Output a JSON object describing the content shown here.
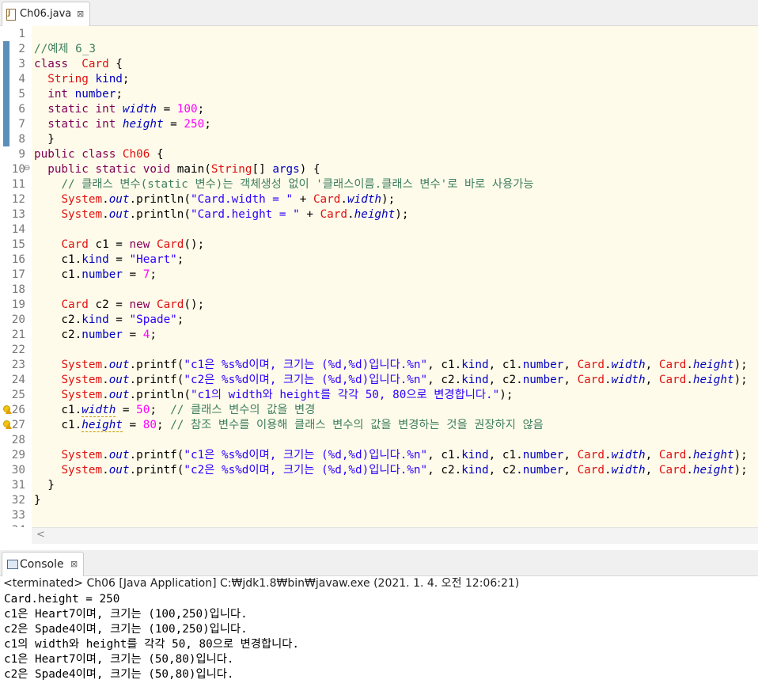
{
  "editor": {
    "tab_label": "Ch06.java",
    "tab_close": "⊠"
  },
  "code_lines": [
    {
      "n": "1",
      "t": []
    },
    {
      "n": "2",
      "t": [
        [
          "cmt",
          "//예제 6_3"
        ]
      ]
    },
    {
      "n": "3",
      "t": [
        [
          "kw",
          "class"
        ],
        [
          "",
          "  "
        ],
        [
          "cls",
          "Card"
        ],
        [
          "",
          " {"
        ]
      ]
    },
    {
      "n": "4",
      "t": [
        [
          "",
          "  "
        ],
        [
          "cls",
          "String"
        ],
        [
          "",
          " "
        ],
        [
          "fld",
          "kind"
        ],
        [
          "",
          ";"
        ]
      ]
    },
    {
      "n": "5",
      "t": [
        [
          "",
          "  "
        ],
        [
          "kw",
          "int"
        ],
        [
          "",
          " "
        ],
        [
          "fld",
          "number"
        ],
        [
          "",
          ";"
        ]
      ]
    },
    {
      "n": "6",
      "t": [
        [
          "",
          "  "
        ],
        [
          "kw",
          "static"
        ],
        [
          "",
          " "
        ],
        [
          "kw",
          "int"
        ],
        [
          "",
          " "
        ],
        [
          "sfld",
          "width"
        ],
        [
          "",
          " = "
        ],
        [
          "num",
          "100"
        ],
        [
          "",
          ";"
        ]
      ]
    },
    {
      "n": "7",
      "t": [
        [
          "",
          "  "
        ],
        [
          "kw",
          "static"
        ],
        [
          "",
          " "
        ],
        [
          "kw",
          "int"
        ],
        [
          "",
          " "
        ],
        [
          "sfld",
          "height"
        ],
        [
          "",
          " = "
        ],
        [
          "num",
          "250"
        ],
        [
          "",
          ";"
        ]
      ]
    },
    {
      "n": "8",
      "t": [
        [
          "",
          "  }"
        ]
      ]
    },
    {
      "n": "9",
      "t": [
        [
          "kw",
          "public"
        ],
        [
          "",
          " "
        ],
        [
          "kw",
          "class"
        ],
        [
          "",
          " "
        ],
        [
          "cls",
          "Ch06"
        ],
        [
          "",
          " {"
        ]
      ]
    },
    {
      "n": "10",
      "t": [
        [
          "",
          "  "
        ],
        [
          "kw",
          "public"
        ],
        [
          "",
          " "
        ],
        [
          "kw",
          "static"
        ],
        [
          "",
          " "
        ],
        [
          "kw",
          "void"
        ],
        [
          "",
          " main("
        ],
        [
          "cls",
          "String"
        ],
        [
          "",
          "[] "
        ],
        [
          "fld",
          "args"
        ],
        [
          "",
          ") {"
        ]
      ]
    },
    {
      "n": "11",
      "t": [
        [
          "",
          "    "
        ],
        [
          "cmt",
          "// 클래스 변수(static 변수)는 객체생성 없이 '클래스이름.클래스 변수'로 바로 사용가능"
        ]
      ]
    },
    {
      "n": "12",
      "t": [
        [
          "",
          "    "
        ],
        [
          "cls",
          "System"
        ],
        [
          "",
          "."
        ],
        [
          "out",
          "out"
        ],
        [
          "",
          ".println("
        ],
        [
          "str",
          "\"Card.width = \""
        ],
        [
          "",
          " + "
        ],
        [
          "cls",
          "Card"
        ],
        [
          "",
          "."
        ],
        [
          "sfld",
          "width"
        ],
        [
          "",
          ");"
        ]
      ]
    },
    {
      "n": "13",
      "t": [
        [
          "",
          "    "
        ],
        [
          "cls",
          "System"
        ],
        [
          "",
          "."
        ],
        [
          "out",
          "out"
        ],
        [
          "",
          ".println("
        ],
        [
          "str",
          "\"Card.height = \""
        ],
        [
          "",
          " + "
        ],
        [
          "cls",
          "Card"
        ],
        [
          "",
          "."
        ],
        [
          "sfld",
          "height"
        ],
        [
          "",
          ");"
        ]
      ]
    },
    {
      "n": "14",
      "t": []
    },
    {
      "n": "15",
      "t": [
        [
          "",
          "    "
        ],
        [
          "cls",
          "Card"
        ],
        [
          "",
          " c1 = "
        ],
        [
          "kw",
          "new"
        ],
        [
          "",
          " "
        ],
        [
          "cls",
          "Card"
        ],
        [
          "",
          "();"
        ]
      ]
    },
    {
      "n": "16",
      "t": [
        [
          "",
          "    c1."
        ],
        [
          "fld",
          "kind"
        ],
        [
          "",
          " = "
        ],
        [
          "str",
          "\"Heart\""
        ],
        [
          "",
          ";"
        ]
      ]
    },
    {
      "n": "17",
      "t": [
        [
          "",
          "    c1."
        ],
        [
          "fld",
          "number"
        ],
        [
          "",
          " = "
        ],
        [
          "num",
          "7"
        ],
        [
          "",
          ";"
        ]
      ]
    },
    {
      "n": "18",
      "t": []
    },
    {
      "n": "19",
      "t": [
        [
          "",
          "    "
        ],
        [
          "cls",
          "Card"
        ],
        [
          "",
          " c2 = "
        ],
        [
          "kw",
          "new"
        ],
        [
          "",
          " "
        ],
        [
          "cls",
          "Card"
        ],
        [
          "",
          "();"
        ]
      ]
    },
    {
      "n": "20",
      "t": [
        [
          "",
          "    c2."
        ],
        [
          "fld",
          "kind"
        ],
        [
          "",
          " = "
        ],
        [
          "str",
          "\"Spade\""
        ],
        [
          "",
          ";"
        ]
      ]
    },
    {
      "n": "21",
      "t": [
        [
          "",
          "    c2."
        ],
        [
          "fld",
          "number"
        ],
        [
          "",
          " = "
        ],
        [
          "num",
          "4"
        ],
        [
          "",
          ";"
        ]
      ]
    },
    {
      "n": "22",
      "t": []
    },
    {
      "n": "23",
      "t": [
        [
          "",
          "    "
        ],
        [
          "cls",
          "System"
        ],
        [
          "",
          "."
        ],
        [
          "out",
          "out"
        ],
        [
          "",
          ".printf("
        ],
        [
          "str",
          "\"c1은 %s%d이며, 크기는 (%d,%d)입니다.%n\""
        ],
        [
          "",
          ", c1."
        ],
        [
          "fld",
          "kind"
        ],
        [
          "",
          ", c1."
        ],
        [
          "fld",
          "number"
        ],
        [
          "",
          ", "
        ],
        [
          "cls",
          "Card"
        ],
        [
          "",
          "."
        ],
        [
          "sfld",
          "width"
        ],
        [
          "",
          ", "
        ],
        [
          "cls",
          "Card"
        ],
        [
          "",
          "."
        ],
        [
          "sfld",
          "height"
        ],
        [
          "",
          ");"
        ]
      ]
    },
    {
      "n": "24",
      "t": [
        [
          "",
          "    "
        ],
        [
          "cls",
          "System"
        ],
        [
          "",
          "."
        ],
        [
          "out",
          "out"
        ],
        [
          "",
          ".printf("
        ],
        [
          "str",
          "\"c2은 %s%d이며, 크기는 (%d,%d)입니다.%n\""
        ],
        [
          "",
          ", c2."
        ],
        [
          "fld",
          "kind"
        ],
        [
          "",
          ", c2."
        ],
        [
          "fld",
          "number"
        ],
        [
          "",
          ", "
        ],
        [
          "cls",
          "Card"
        ],
        [
          "",
          "."
        ],
        [
          "sfld",
          "width"
        ],
        [
          "",
          ", "
        ],
        [
          "cls",
          "Card"
        ],
        [
          "",
          "."
        ],
        [
          "sfld",
          "height"
        ],
        [
          "",
          ");"
        ]
      ]
    },
    {
      "n": "25",
      "t": [
        [
          "",
          "    "
        ],
        [
          "cls",
          "System"
        ],
        [
          "",
          "."
        ],
        [
          "out",
          "out"
        ],
        [
          "",
          ".println("
        ],
        [
          "str",
          "\"c1의 width와 height를 각각 50, 80으로 변경합니다.\""
        ],
        [
          "",
          ");"
        ]
      ]
    },
    {
      "n": "26",
      "t": [
        [
          "",
          "    c1."
        ],
        [
          "sfld ul",
          "width"
        ],
        [
          "",
          " = "
        ],
        [
          "num",
          "50"
        ],
        [
          "",
          ";  "
        ],
        [
          "cmt",
          "// 클래스 변수의 값을 변경"
        ]
      ]
    },
    {
      "n": "27",
      "t": [
        [
          "",
          "    c1."
        ],
        [
          "sfld ul",
          "height"
        ],
        [
          "",
          " = "
        ],
        [
          "num",
          "80"
        ],
        [
          "",
          "; "
        ],
        [
          "cmt",
          "// 참조 변수를 이용해 클래스 변수의 값을 변경하는 것을 권장하지 않음"
        ]
      ]
    },
    {
      "n": "28",
      "t": []
    },
    {
      "n": "29",
      "t": [
        [
          "",
          "    "
        ],
        [
          "cls",
          "System"
        ],
        [
          "",
          "."
        ],
        [
          "out",
          "out"
        ],
        [
          "",
          ".printf("
        ],
        [
          "str",
          "\"c1은 %s%d이며, 크기는 (%d,%d)입니다.%n\""
        ],
        [
          "",
          ", c1."
        ],
        [
          "fld",
          "kind"
        ],
        [
          "",
          ", c1."
        ],
        [
          "fld",
          "number"
        ],
        [
          "",
          ", "
        ],
        [
          "cls",
          "Card"
        ],
        [
          "",
          "."
        ],
        [
          "sfld",
          "width"
        ],
        [
          "",
          ", "
        ],
        [
          "cls",
          "Card"
        ],
        [
          "",
          "."
        ],
        [
          "sfld",
          "height"
        ],
        [
          "",
          ");"
        ]
      ]
    },
    {
      "n": "30",
      "t": [
        [
          "",
          "    "
        ],
        [
          "cls",
          "System"
        ],
        [
          "",
          "."
        ],
        [
          "out",
          "out"
        ],
        [
          "",
          ".printf("
        ],
        [
          "str",
          "\"c2은 %s%d이며, 크기는 (%d,%d)입니다.%n\""
        ],
        [
          "",
          ", c2."
        ],
        [
          "fld",
          "kind"
        ],
        [
          "",
          ", c2."
        ],
        [
          "fld",
          "number"
        ],
        [
          "",
          ", "
        ],
        [
          "cls",
          "Card"
        ],
        [
          "",
          "."
        ],
        [
          "sfld",
          "width"
        ],
        [
          "",
          ", "
        ],
        [
          "cls",
          "Card"
        ],
        [
          "",
          "."
        ],
        [
          "sfld",
          "height"
        ],
        [
          "",
          ");"
        ]
      ]
    },
    {
      "n": "31",
      "t": [
        [
          "",
          "  }"
        ]
      ]
    },
    {
      "n": "32",
      "t": [
        [
          "",
          "}"
        ]
      ]
    },
    {
      "n": "33",
      "t": []
    },
    {
      "n": "34",
      "t": []
    }
  ],
  "console": {
    "tab_label": "Console",
    "tab_close": "⊠",
    "status": "<terminated> Ch06 [Java Application] C:₩jdk1.8₩bin₩javaw.exe (2021. 1. 4. 오전 12:06:21)",
    "output": [
      "Card.height = 250",
      "c1은 Heart7이며, 크기는 (100,250)입니다.",
      "c2은 Spade4이며, 크기는 (100,250)입니다.",
      "c1의 width와 height를 각각 50, 80으로 변경합니다.",
      "c1은 Heart7이며, 크기는 (50,80)입니다.",
      "c2은 Spade4이며, 크기는 (50,80)입니다."
    ]
  },
  "icons": [
    "java-file-icon",
    "close-icon",
    "fold-collapse-icon",
    "warning-icon",
    "console-icon",
    "scroll-left-icon"
  ]
}
